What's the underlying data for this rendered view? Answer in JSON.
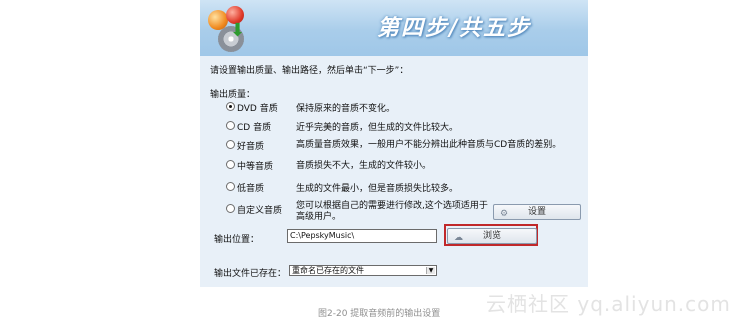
{
  "header": {
    "title": "第四步/共五步",
    "logo_icon": "audio-extract-logo-icon"
  },
  "instruction": "请设置输出质量、输出路径，然后单击“下一步”：",
  "quality": {
    "label": "输出质量：",
    "selected": "DVD 音质",
    "options": [
      {
        "label": "DVD 音质",
        "desc": "保持原来的音质不变化。",
        "checked": true
      },
      {
        "label": "CD 音质",
        "desc": "近乎完美的音质，但生成的文件比较大。",
        "checked": false
      },
      {
        "label": "好音质",
        "desc": "高质量音质效果，一般用户不能分辨出此种音质与CD音质的差别。",
        "checked": false
      },
      {
        "label": "中等音质",
        "desc": "音质损失不大，生成的文件较小。",
        "checked": false
      },
      {
        "label": "低音质",
        "desc": "生成的文件最小，但是音质损失比较多。",
        "checked": false
      },
      {
        "label": "自定义音质",
        "desc": "您可以根据自己的需要进行修改,这个选项适用于高级用户。",
        "checked": false
      }
    ],
    "settings_button": "设置"
  },
  "output": {
    "location_label": "输出位置：",
    "path_value": "C:\\PepskyMusic\\",
    "browse_button": "浏览",
    "exists_label": "输出文件已存在：",
    "exists_selected": "重命名已存在的文件"
  },
  "caption": "图2-20 提取音频前的输出设置",
  "watermark": "云栖社区 yq.aliyun.com",
  "colors": {
    "header_bg": "#a9cdea",
    "dialog_bg": "#e8f0f8",
    "highlight": "#c0282a"
  }
}
